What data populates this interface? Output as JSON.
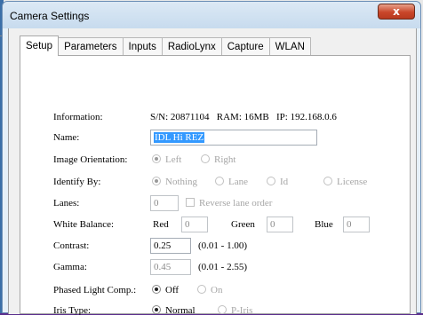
{
  "window": {
    "title": "Camera Settings",
    "close_glyph": "x"
  },
  "tabs": [
    {
      "label": "Setup",
      "active": true
    },
    {
      "label": "Parameters"
    },
    {
      "label": "Inputs"
    },
    {
      "label": "RadioLynx"
    },
    {
      "label": "Capture"
    },
    {
      "label": "WLAN"
    }
  ],
  "setup": {
    "information": {
      "label": "Information:",
      "value": "S/N: 20871104   RAM: 16MB   IP: 192.168.0.6"
    },
    "name": {
      "label": "Name:",
      "value": "IDL Hi REZ"
    },
    "image_orientation": {
      "label": "Image Orientation:",
      "options": [
        "Left",
        "Right"
      ],
      "selected": "Left"
    },
    "identify_by": {
      "label": "Identify By:",
      "options": [
        "Nothing",
        "Lane",
        "Id",
        "License"
      ],
      "selected": "Nothing"
    },
    "lanes": {
      "label": "Lanes:",
      "value": "0",
      "reverse_label": "Reverse lane order"
    },
    "white_balance": {
      "label": "White Balance:",
      "red_label": "Red",
      "red_value": "0",
      "green_label": "Green",
      "green_value": "0",
      "blue_label": "Blue",
      "blue_value": "0"
    },
    "contrast": {
      "label": "Contrast:",
      "value": "0.25",
      "range": "(0.01 - 1.00)"
    },
    "gamma": {
      "label": "Gamma:",
      "value": "0.45",
      "range": "(0.01 - 2.55)"
    },
    "phased_light": {
      "label": "Phased Light Comp.:",
      "options": [
        "Off",
        "On"
      ],
      "selected": "Off"
    },
    "iris_type": {
      "label": "Iris Type:",
      "options": [
        "Normal",
        "P-Iris"
      ],
      "selected": "Normal"
    }
  },
  "colors": {
    "title_close": "#c9462a",
    "selection": "#3399ff",
    "frame": "#5a2d8c"
  }
}
